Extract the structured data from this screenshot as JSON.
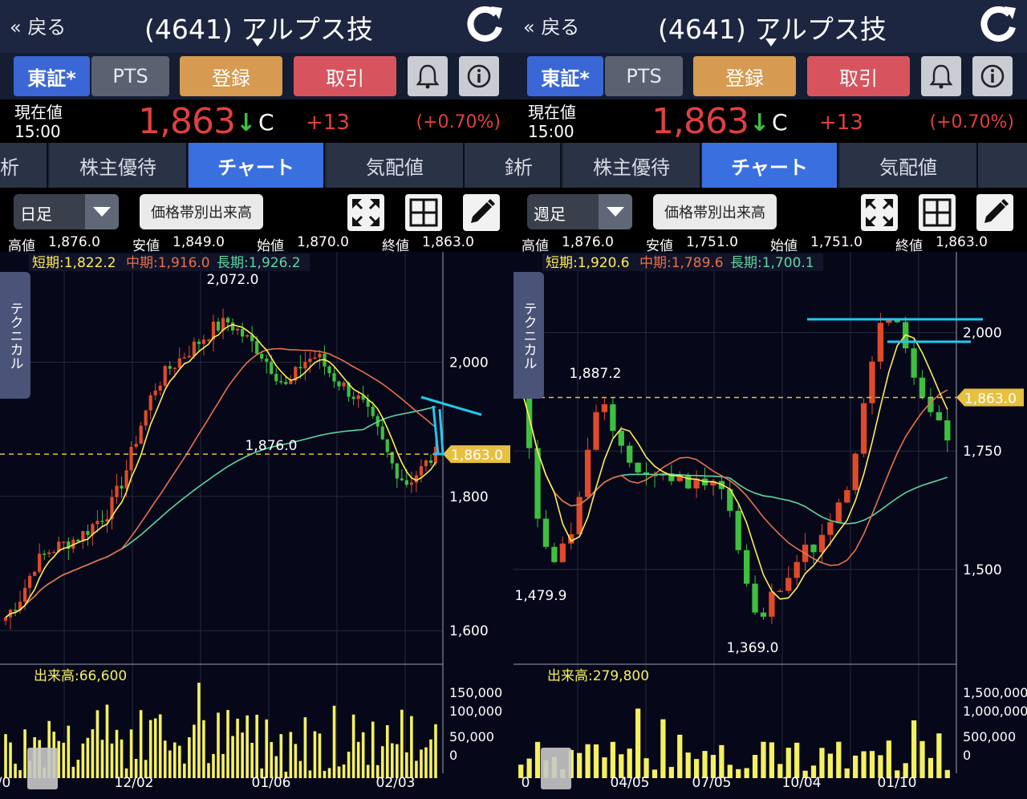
{
  "panes": [
    {
      "nav": {
        "back": "« 戻る",
        "title": "(4641) アルプス技"
      },
      "buttons": {
        "tosho": "東証*",
        "pts": "PTS",
        "register": "登録",
        "trade": "取引"
      },
      "quote": {
        "label_now": "現在値",
        "time": "15:00",
        "price": "1,863",
        "arrow": "↓",
        "mark": "C",
        "change": "+13",
        "pct": "(+0.70%)"
      },
      "tabs": [
        {
          "label": "析"
        },
        {
          "label": "株主優待"
        },
        {
          "label": "チャート"
        },
        {
          "label": "気配値"
        },
        {
          "label": "銘析"
        }
      ],
      "toolbar": {
        "period": "日足",
        "volume_profile": "価格帯別出来高"
      },
      "ohlc": {
        "high_label": "高値",
        "high": "1,876.0",
        "low_label": "安値",
        "low": "1,849.0",
        "open_label": "始値",
        "open": "1,870.0",
        "close_label": "終値",
        "close": "1,863.0"
      },
      "technical": "テクニカル",
      "chart_data": {
        "type": "candlestick",
        "ma_labels": {
          "short": "短期:1,822.2",
          "mid": "中期:1,916.0",
          "long": "長期:1,926.2"
        },
        "y_ticks": [
          "2,000",
          "1,800",
          "1,600"
        ],
        "x_ticks": [
          "/0",
          "12/02",
          "01/06",
          "02/03"
        ],
        "annotations": {
          "max": "2,072.0",
          "mid": "1,876.0",
          "current": "1,863.0"
        },
        "volume_label": "出来高:66,600",
        "volume_ticks": [
          "150,000",
          "100,000",
          "50,000",
          "0"
        ]
      }
    },
    {
      "nav": {
        "back": "« 戻る",
        "title": "(4641) アルプス技"
      },
      "buttons": {
        "tosho": "東証*",
        "pts": "PTS",
        "register": "登録",
        "trade": "取引"
      },
      "quote": {
        "label_now": "現在値",
        "time": "15:00",
        "price": "1,863",
        "arrow": "↓",
        "mark": "C",
        "change": "+13",
        "pct": "(+0.70%)"
      },
      "tabs": [
        {
          "label": "析"
        },
        {
          "label": "株主優待"
        },
        {
          "label": "チャート"
        },
        {
          "label": "気配値"
        },
        {
          "label": "銘"
        }
      ],
      "toolbar": {
        "period": "週足",
        "volume_profile": "価格帯別出来高"
      },
      "ohlc": {
        "high_label": "高値",
        "high": "1,876.0",
        "low_label": "安値",
        "low": "1,751.0",
        "open_label": "始値",
        "open": "1,751.0",
        "close_label": "終値",
        "close": "1,863.0"
      },
      "technical": "テクニカル",
      "chart_data": {
        "type": "candlestick",
        "ma_labels": {
          "short": "短期:1,920.6",
          "mid": "中期:1,789.6",
          "long": "長期:1,700.1"
        },
        "y_ticks": [
          "2,000",
          "1,750",
          "1,500"
        ],
        "x_ticks": [
          "0",
          "04/05",
          "07/05",
          "10/04",
          "01/10"
        ],
        "annotations": {
          "max": "1,887.2",
          "low1": "1,479.9",
          "low2": "1,369.0",
          "current": "1,863.0"
        },
        "volume_label": "出来高:279,800",
        "volume_ticks": [
          "1,500,000",
          "1,000,000",
          "500,000",
          "0"
        ]
      }
    }
  ],
  "colors": {
    "up": "#e04a2a",
    "down": "#3fbf3f",
    "ma_short": "#ffee55",
    "ma_mid": "#e8704a",
    "ma_long": "#5fd6a0",
    "volume": "#f5f060",
    "current": "#e8c040",
    "draw": "#22c8ee"
  }
}
